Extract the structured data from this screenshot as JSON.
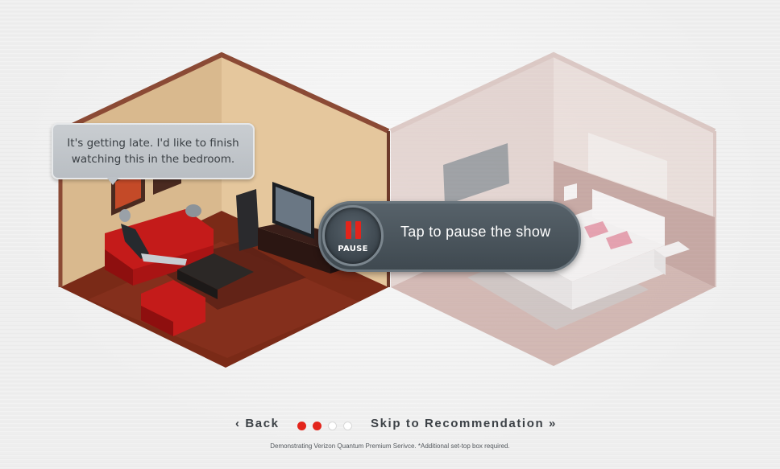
{
  "speech_bubble": {
    "line1": "It's getting late. I'd like to finish",
    "line2": "watching this in the bedroom."
  },
  "pause_control": {
    "button_label": "PAUSE",
    "prompt": "Tap to pause the show",
    "bar_color": "#e3241b"
  },
  "navigation": {
    "back_label": "‹ Back",
    "skip_label": "Skip to Recommendation »",
    "progress_dots": [
      {
        "state": "active",
        "color": "#e3241b"
      },
      {
        "state": "active",
        "color": "#e3241b"
      },
      {
        "state": "inactive",
        "color": "#ffffff"
      },
      {
        "state": "inactive",
        "color": "#ffffff"
      }
    ]
  },
  "footnote": "Demonstrating Verizon Quantum Premium Serivce. *Additional set-top box required.",
  "scenes": {
    "living_room": "living-room",
    "bedroom": "bedroom"
  }
}
